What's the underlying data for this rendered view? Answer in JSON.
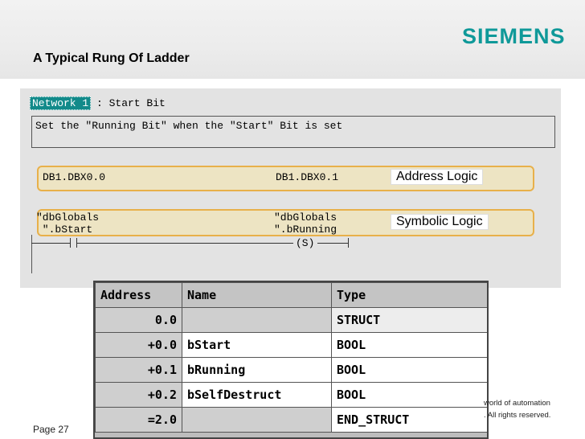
{
  "logo": "SIEMENS",
  "slide_title": "A Typical Rung Of Ladder",
  "network": {
    "label": "Network 1",
    "title": ": Start Bit",
    "comment": "Set the \"Running Bit\" when the \"Start\" Bit is set"
  },
  "address_row": {
    "contact_address": "DB1.DBX0.0",
    "coil_address": "DB1.DBX0.1",
    "label": "Address Logic"
  },
  "symbolic_row": {
    "contact_line1": "\"dbGlobals",
    "contact_line2": " \".bStart",
    "coil_line1": "\"dbGlobals",
    "coil_line2": "\".bRunning",
    "label": "Symbolic Logic"
  },
  "coil_symbol": "(S)",
  "table": {
    "headers": [
      "Address",
      "Name",
      "Type"
    ],
    "rows": [
      {
        "address": "0.0",
        "name": "",
        "type": "STRUCT"
      },
      {
        "address": "+0.0",
        "name": "bStart",
        "type": "BOOL"
      },
      {
        "address": "+0.1",
        "name": "bRunning",
        "type": "BOOL"
      },
      {
        "address": "+0.2",
        "name": "bSelfDestruct",
        "type": "BOOL"
      },
      {
        "address": "=2.0",
        "name": "",
        "type": "END_STRUCT"
      }
    ]
  },
  "footer": {
    "line1": "world of automation",
    "line2": ". All rights reserved.",
    "page": "Page 27"
  }
}
